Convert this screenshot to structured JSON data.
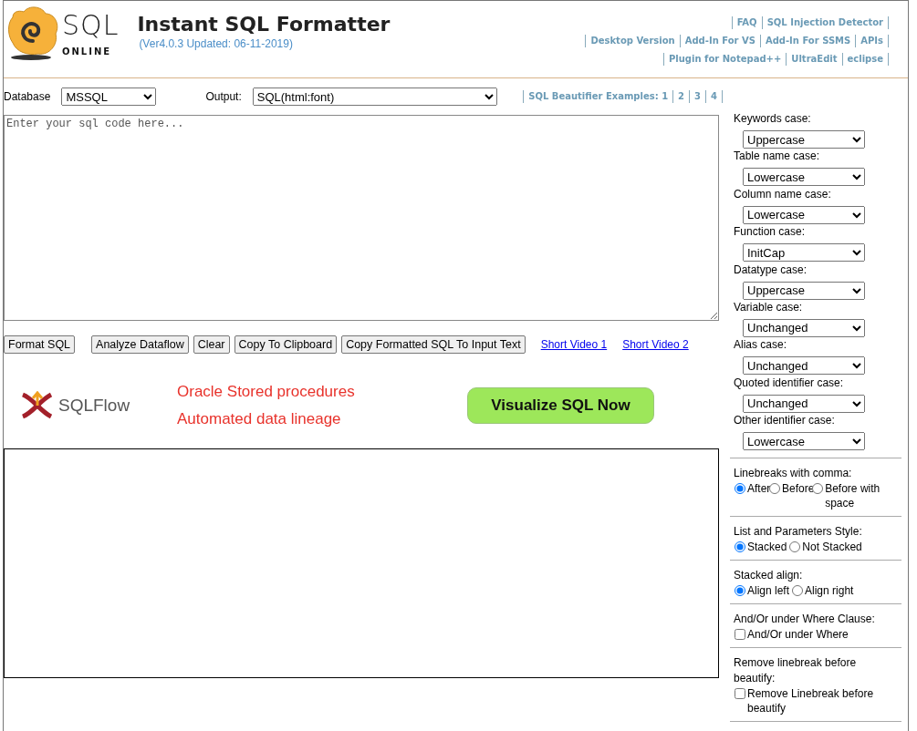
{
  "header": {
    "logo_text": "SQL",
    "logo_subtext": "ONLINE",
    "title": "Instant SQL Formatter",
    "version": "(Ver4.0.3 Updated: 06-11-2019)",
    "nav_rows": [
      [
        "FAQ",
        "SQL Injection Detector"
      ],
      [
        "Desktop Version",
        "Add-In For VS",
        "Add-In For SSMS",
        "APIs"
      ],
      [
        "Plugin for Notepad++",
        "UltraEdit",
        "eclipse"
      ]
    ]
  },
  "toolbar": {
    "database": {
      "label": "Database",
      "value": "MSSQL"
    },
    "output": {
      "label": "Output:",
      "value": "SQL(html:font)"
    },
    "examples": [
      "SQL Beautifier Examples: 1",
      "2",
      "3",
      "4"
    ]
  },
  "editor": {
    "placeholder": "Enter your sql code here..."
  },
  "buttons": [
    "Format SQL",
    "Analyze Dataflow",
    "Clear",
    "Copy To Clipboard",
    "Copy Formatted SQL To Input Text"
  ],
  "video_links": [
    "Short Video 1",
    "Short Video 2"
  ],
  "banner": {
    "brand": "SQLFlow",
    "lines": [
      "Oracle Stored procedures",
      "Automated data lineage"
    ],
    "button": "Visualize SQL Now"
  },
  "options": {
    "selects": [
      {
        "label": "Keywords case:",
        "value": "Uppercase"
      },
      {
        "label": "Table name case:",
        "value": "Lowercase"
      },
      {
        "label": "Column name case:",
        "value": "Lowercase"
      },
      {
        "label": "Function case:",
        "value": "InitCap"
      },
      {
        "label": "Datatype case:",
        "value": "Uppercase"
      },
      {
        "label": "Variable case:",
        "value": "Unchanged"
      },
      {
        "label": "Alias case:",
        "value": "Unchanged"
      },
      {
        "label": "Quoted identifier case:",
        "value": "Unchanged"
      },
      {
        "label": "Other identifier case:",
        "value": "Lowercase"
      }
    ],
    "groups": [
      {
        "kind": "radio",
        "title": "Linebreaks with comma:",
        "options": [
          {
            "label": "After",
            "selected": true
          },
          {
            "label": "Before",
            "selected": false
          },
          {
            "label": "Before with space",
            "selected": false
          }
        ]
      },
      {
        "kind": "radio",
        "title": "List and Parameters Style:",
        "options": [
          {
            "label": "Stacked",
            "selected": true
          },
          {
            "label": "Not Stacked",
            "selected": false
          }
        ]
      },
      {
        "kind": "radio",
        "title": "Stacked align:",
        "options": [
          {
            "label": "Align left",
            "selected": true
          },
          {
            "label": "Align right",
            "selected": false
          }
        ]
      },
      {
        "kind": "checkbox",
        "title": "And/Or under Where Clause:",
        "options": [
          {
            "label": "And/Or under Where",
            "checked": false
          }
        ]
      },
      {
        "kind": "checkbox",
        "title": "Remove linebreak before beautify:",
        "options": [
          {
            "label": "Remove Linebreak before beautify",
            "checked": false
          }
        ]
      }
    ]
  }
}
